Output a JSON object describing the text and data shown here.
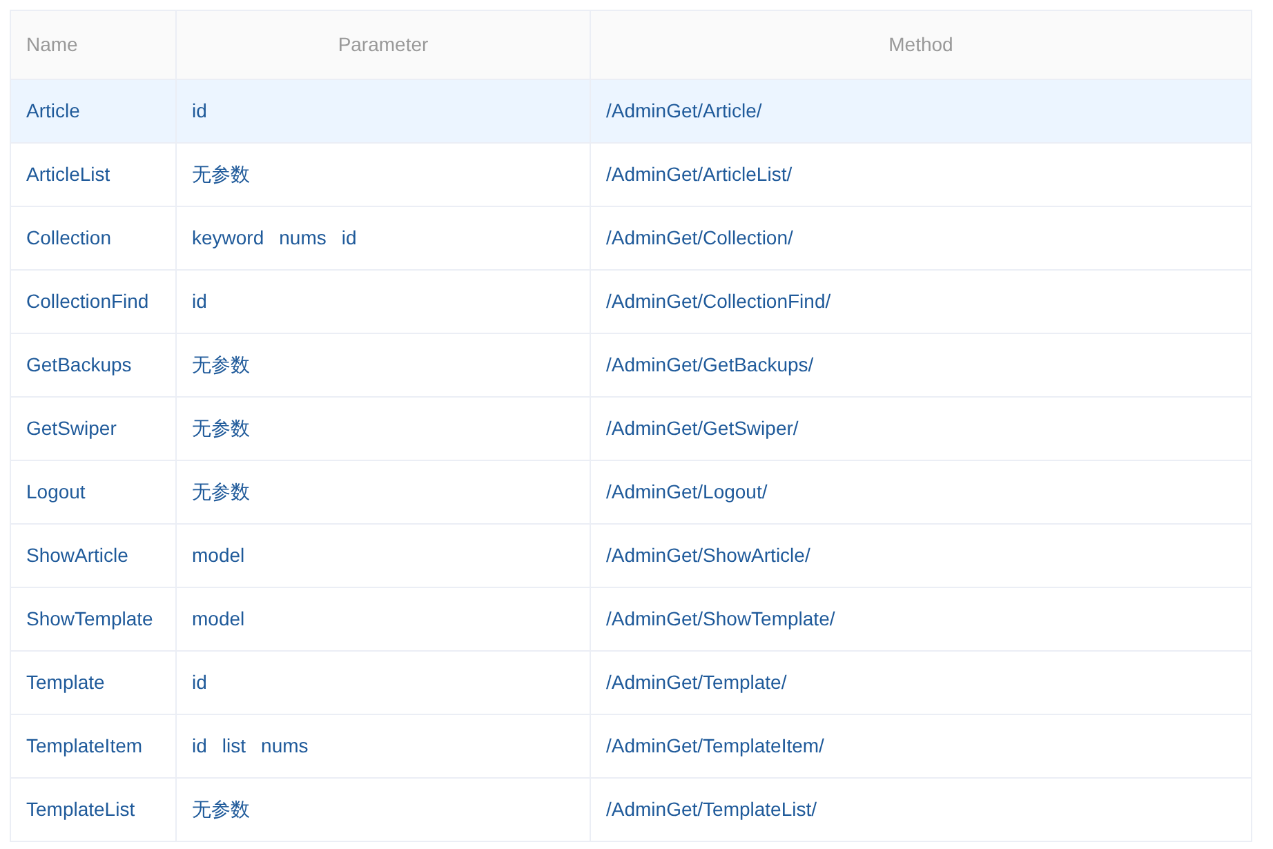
{
  "table": {
    "columns": [
      "Name",
      "Parameter",
      "Method"
    ],
    "rows": [
      {
        "name": "Article",
        "params": [
          "id"
        ],
        "method": "/AdminGet/Article/",
        "selected": true
      },
      {
        "name": "ArticleList",
        "params": [
          "无参数"
        ],
        "method": "/AdminGet/ArticleList/",
        "selected": false
      },
      {
        "name": "Collection",
        "params": [
          "keyword",
          "nums",
          "id"
        ],
        "method": "/AdminGet/Collection/",
        "selected": false
      },
      {
        "name": "CollectionFind",
        "params": [
          "id"
        ],
        "method": "/AdminGet/CollectionFind/",
        "selected": false
      },
      {
        "name": "GetBackups",
        "params": [
          "无参数"
        ],
        "method": "/AdminGet/GetBackups/",
        "selected": false
      },
      {
        "name": "GetSwiper",
        "params": [
          "无参数"
        ],
        "method": "/AdminGet/GetSwiper/",
        "selected": false
      },
      {
        "name": "Logout",
        "params": [
          "无参数"
        ],
        "method": "/AdminGet/Logout/",
        "selected": false
      },
      {
        "name": "ShowArticle",
        "params": [
          "model"
        ],
        "method": "/AdminGet/ShowArticle/",
        "selected": false
      },
      {
        "name": "ShowTemplate",
        "params": [
          "model"
        ],
        "method": "/AdminGet/ShowTemplate/",
        "selected": false
      },
      {
        "name": "Template",
        "params": [
          "id"
        ],
        "method": "/AdminGet/Template/",
        "selected": false
      },
      {
        "name": "TemplateItem",
        "params": [
          "id",
          "list",
          "nums"
        ],
        "method": "/AdminGet/TemplateItem/",
        "selected": false
      },
      {
        "name": "TemplateList",
        "params": [
          "无参数"
        ],
        "method": "/AdminGet/TemplateList/",
        "selected": false
      }
    ]
  }
}
